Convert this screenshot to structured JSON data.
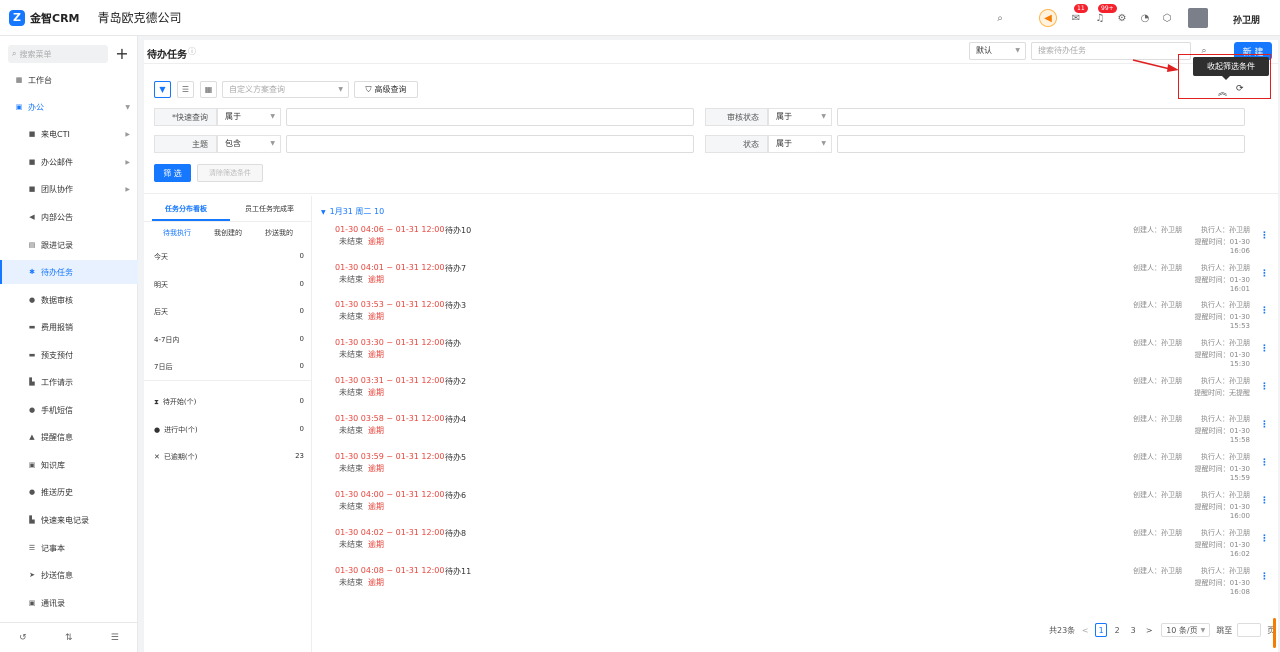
{
  "header": {
    "logo_mark": "Z",
    "app_name": "金智CRM",
    "company": "青岛欧克德公司",
    "badge_messages": "11",
    "badge_notices": "99+",
    "user_name": "孙卫朋"
  },
  "sidebar": {
    "search_placeholder": "搜索菜单",
    "plus": "+",
    "items": [
      {
        "label": "工作台"
      },
      {
        "label": "办公"
      },
      {
        "label": "来电CTI"
      },
      {
        "label": "办公邮件"
      },
      {
        "label": "团队协作"
      },
      {
        "label": "内部公告"
      },
      {
        "label": "跟进记录"
      },
      {
        "label": "待办任务"
      },
      {
        "label": "数据审核"
      },
      {
        "label": "费用报销"
      },
      {
        "label": "预支预付"
      },
      {
        "label": "工作请示"
      },
      {
        "label": "手机短信"
      },
      {
        "label": "提醒信息"
      },
      {
        "label": "知识库"
      },
      {
        "label": "推送历史"
      },
      {
        "label": "快速来电记录"
      },
      {
        "label": "记事本"
      },
      {
        "label": "抄送信息"
      },
      {
        "label": "通讯录"
      }
    ]
  },
  "page": {
    "title": "待办任务",
    "default_select": "默认",
    "search_placeholder": "搜索待办任务",
    "new_button": "新 建",
    "tooltip": "收起筛选条件"
  },
  "filters": {
    "scheme_placeholder": "自定义方案查询",
    "advanced": "高级查询",
    "row1": {
      "label_a": "*快速查询",
      "op_a": "属于",
      "label_b": "审核状态",
      "op_b": "属于"
    },
    "row2": {
      "label_a": "主题",
      "op_a": "包含",
      "label_b": "状态",
      "op_b": "属于"
    },
    "filter_button": "筛 选",
    "clear_button": "清除筛选条件"
  },
  "left_panel": {
    "tab_board": "任务分布看板",
    "tab_rate": "员工任务完成率",
    "sub_todo": "待我执行",
    "sub_created": "我创建的",
    "sub_cc": "抄送我的",
    "rows": [
      {
        "label": "今天",
        "count": "0"
      },
      {
        "label": "明天",
        "count": "0"
      },
      {
        "label": "后天",
        "count": "0"
      },
      {
        "label": "4-7日内",
        "count": "0"
      },
      {
        "label": "7日后",
        "count": "0"
      }
    ],
    "status_rows": [
      {
        "label": "待开始(个)",
        "count": "0"
      },
      {
        "label": "进行中(个)",
        "count": "0"
      },
      {
        "label": "已逾期(个)",
        "count": "23"
      }
    ]
  },
  "tasks": {
    "date_header": "1月31  周二  10",
    "items": [
      {
        "time": "01-30 04:06 ~ 01-31 12:00",
        "state": "未结束",
        "overdue": "逾期",
        "name": "待办10",
        "creator": "创建人：孙卫朋",
        "executor": "执行人：孙卫朋",
        "remind": "提醒时间：01-30 16:06"
      },
      {
        "time": "01-30 04:01 ~ 01-31 12:00",
        "state": "未结束",
        "overdue": "逾期",
        "name": "待办7",
        "creator": "创建人：孙卫朋",
        "executor": "执行人：孙卫朋",
        "remind": "提醒时间：01-30 16:01"
      },
      {
        "time": "01-30 03:53 ~ 01-31 12:00",
        "state": "未结束",
        "overdue": "逾期",
        "name": "待办3",
        "creator": "创建人：孙卫朋",
        "executor": "执行人：孙卫朋",
        "remind": "提醒时间：01-30 15:53"
      },
      {
        "time": "01-30 03:30 ~ 01-31 12:00",
        "state": "未结束",
        "overdue": "逾期",
        "name": "待办",
        "creator": "创建人：孙卫朋",
        "executor": "执行人：孙卫朋",
        "remind": "提醒时间：01-30 15:30"
      },
      {
        "time": "01-30 03:31 ~ 01-31 12:00",
        "state": "未结束",
        "overdue": "逾期",
        "name": "待办2",
        "creator": "创建人：孙卫朋",
        "executor": "执行人：孙卫朋",
        "remind": "提醒时间：无提醒"
      },
      {
        "time": "01-30 03:58 ~ 01-31 12:00",
        "state": "未结束",
        "overdue": "逾期",
        "name": "待办4",
        "creator": "创建人：孙卫朋",
        "executor": "执行人：孙卫朋",
        "remind": "提醒时间：01-30 15:58"
      },
      {
        "time": "01-30 03:59 ~ 01-31 12:00",
        "state": "未结束",
        "overdue": "逾期",
        "name": "待办5",
        "creator": "创建人：孙卫朋",
        "executor": "执行人：孙卫朋",
        "remind": "提醒时间：01-30 15:59"
      },
      {
        "time": "01-30 04:00 ~ 01-31 12:00",
        "state": "未结束",
        "overdue": "逾期",
        "name": "待办6",
        "creator": "创建人：孙卫朋",
        "executor": "执行人：孙卫朋",
        "remind": "提醒时间：01-30 16:00"
      },
      {
        "time": "01-30 04:02 ~ 01-31 12:00",
        "state": "未结束",
        "overdue": "逾期",
        "name": "待办8",
        "creator": "创建人：孙卫朋",
        "executor": "执行人：孙卫朋",
        "remind": "提醒时间：01-30 16:02"
      },
      {
        "time": "01-30 04:08 ~ 01-31 12:00",
        "state": "未结束",
        "overdue": "逾期",
        "name": "待办11",
        "creator": "创建人：孙卫朋",
        "executor": "执行人：孙卫朋",
        "remind": "提醒时间：01-30 16:08"
      }
    ]
  },
  "pagination": {
    "total": "共23条",
    "prev": "<",
    "pages": [
      "1",
      "2",
      "3"
    ],
    "next": ">",
    "page_size": "10 条/页",
    "jump_label": "跳至",
    "page_unit": "页"
  },
  "colors": {
    "accent": "#1677ff",
    "overdue": "#e8453c",
    "highlight_box": "#e02020"
  }
}
